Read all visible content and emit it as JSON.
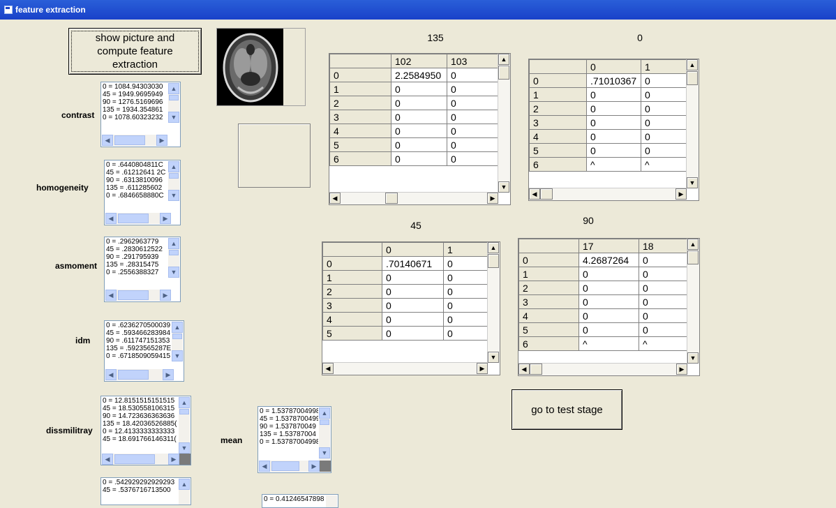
{
  "window": {
    "title": "feature extraction"
  },
  "buttons": {
    "show_picture": "show picture and compute feature extraction",
    "go_test": "go to test stage"
  },
  "features": {
    "contrast": {
      "label": "contrast",
      "items": [
        "0 = 1084.94303030",
        "45 = 1949.9695949",
        "90 = 1276.5169696",
        "135 = 1934.354861",
        "0 = 1078.60323232"
      ]
    },
    "homogeneity": {
      "label": "homogeneity",
      "items": [
        "0 = .6440804811C",
        "45 = .61212641 2C",
        "90 = .6313810096",
        "135 = .611285602",
        "0 = .6846658880C"
      ]
    },
    "asmoment": {
      "label": "asmoment",
      "items": [
        "0 = .2962963779",
        "45 = .2830612522",
        "90 = .291795939",
        "135 = .28315475",
        "0 = .2556388327"
      ]
    },
    "idm": {
      "label": "idm",
      "items": [
        "0 = .6236270500039",
        "45 = .593466283984",
        "90 = .611747151353",
        "135 = .5923565287E",
        "0 = .6718509059415"
      ]
    },
    "dissmilitray": {
      "label": "dissmilitray",
      "items": [
        "0 = 12.8151515151515",
        "45 = 18.530558106315",
        "90 = 14.723636363636",
        "135 = 18.42036526885(",
        "0 = 12.4133333333333",
        "45 = 18.691766146311("
      ]
    },
    "mean": {
      "label": "mean",
      "items": [
        "0 = 1.53787004998",
        "45 = 1.5378700499",
        "90 = 1.537870049",
        "135 = 1.53787004",
        "0 = 1.53787004998"
      ]
    },
    "partial1": {
      "items": [
        "0 = .542929292929293",
        "45 = .5376716713500"
      ]
    },
    "partial2": {
      "items": [
        "0 = 0.41246547898"
      ]
    }
  },
  "grids": {
    "g135": {
      "title": "135",
      "cols": [
        "102",
        "103"
      ],
      "rows": [
        [
          "0",
          "2.2584950",
          "0"
        ],
        [
          "1",
          "0",
          "0"
        ],
        [
          "2",
          "0",
          "0"
        ],
        [
          "3",
          "0",
          "0"
        ],
        [
          "4",
          "0",
          "0"
        ],
        [
          "5",
          "0",
          "0"
        ],
        [
          "6",
          "0",
          "0"
        ]
      ]
    },
    "g0": {
      "title": "0",
      "cols": [
        "0",
        "1"
      ],
      "rows": [
        [
          "0",
          ".71010367",
          "0"
        ],
        [
          "1",
          "0",
          "0"
        ],
        [
          "2",
          "0",
          "0"
        ],
        [
          "3",
          "0",
          "0"
        ],
        [
          "4",
          "0",
          "0"
        ],
        [
          "5",
          "0",
          "0"
        ],
        [
          "6",
          "^",
          "^"
        ]
      ]
    },
    "g45": {
      "title": "45",
      "cols": [
        "0",
        "1"
      ],
      "rows": [
        [
          "0",
          ".70140671",
          "0"
        ],
        [
          "1",
          "0",
          "0"
        ],
        [
          "2",
          "0",
          "0"
        ],
        [
          "3",
          "0",
          "0"
        ],
        [
          "4",
          "0",
          "0"
        ],
        [
          "5",
          "0",
          "0"
        ]
      ]
    },
    "g90": {
      "title": "90",
      "cols": [
        "17",
        "18"
      ],
      "rows": [
        [
          "0",
          "4.2687264",
          "0"
        ],
        [
          "1",
          "0",
          "0"
        ],
        [
          "2",
          "0",
          "0"
        ],
        [
          "3",
          "0",
          "0"
        ],
        [
          "4",
          "0",
          "0"
        ],
        [
          "5",
          "0",
          "0"
        ],
        [
          "6",
          "^",
          "^"
        ]
      ]
    }
  },
  "image": {
    "description_icon": "brain-mri-image"
  }
}
